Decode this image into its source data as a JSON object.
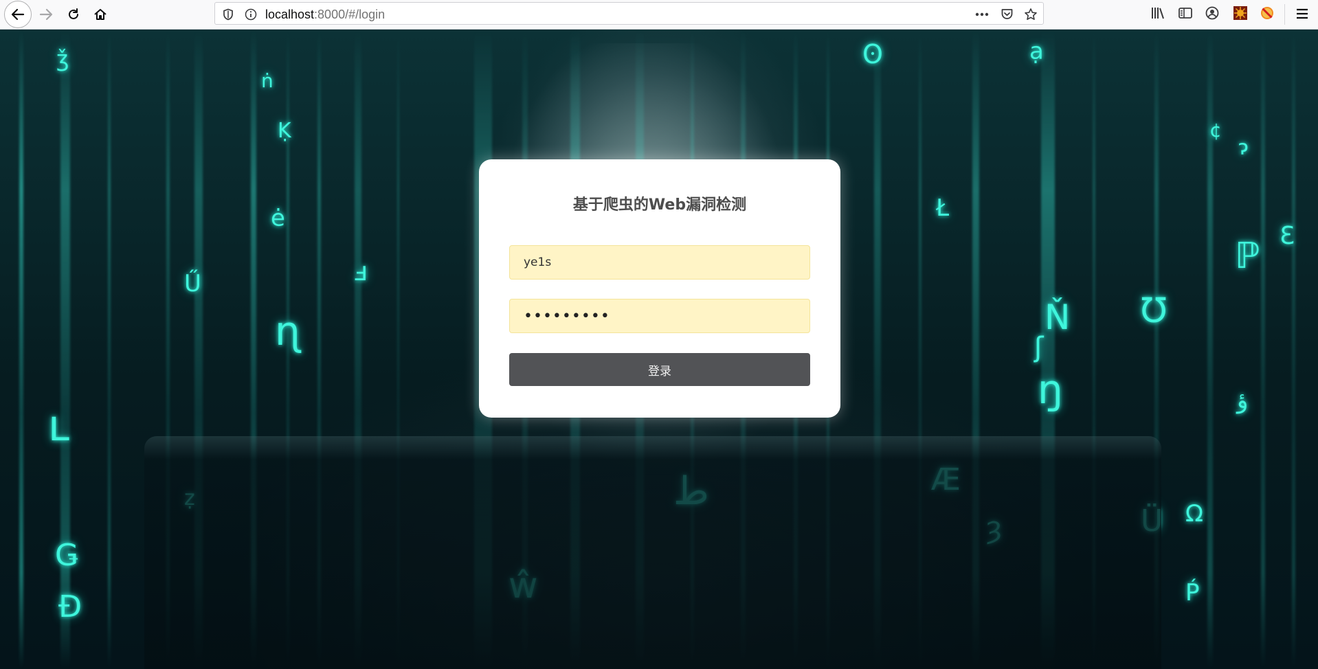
{
  "browser": {
    "url_host": "localhost",
    "url_rest": ":8000/#/login"
  },
  "login": {
    "title": "基于爬虫的Web漏洞检测",
    "username_value": "ye1s",
    "password_value": "•••••••••",
    "submit_label": "登录"
  },
  "background": {
    "glyph_color": "#3ff5dc",
    "glyphs": [
      "ʘ",
      "ạ",
      "ǯ",
      "ṅ",
      "Ḳ",
      "Ű",
      "ɳ",
      "ʟ",
      "Ɛ",
      "ℙ",
      "Ʊ",
      "ẓ",
      "Ǥ",
      "Đ",
      "ŵ",
      "Ł",
      "ŋ",
      "Ň",
      "Æ",
      "Ü",
      "Ω",
      "Ṕ",
      "ȝ",
      "ʃ",
      "ė",
      "ⅎ",
      "ɂ",
      "¢",
      "ؤ",
      "ط"
    ]
  },
  "colors": {
    "card_bg": "#ffffff",
    "input_bg": "#fff4c6",
    "button_bg": "#525356"
  }
}
